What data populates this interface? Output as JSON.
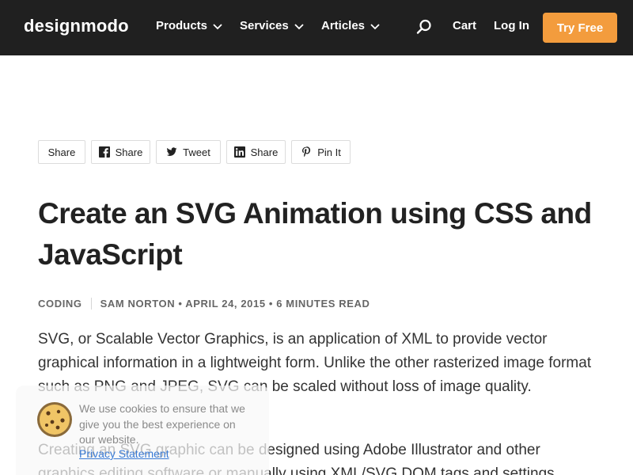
{
  "nav": {
    "logo": "designmodo",
    "items": [
      {
        "label": "Products"
      },
      {
        "label": "Services"
      },
      {
        "label": "Articles"
      }
    ],
    "cart": "Cart",
    "login": "Log In",
    "cta": "Try Free",
    "colors": {
      "bar": "#202020",
      "cta": "#f39c3d"
    }
  },
  "share": [
    {
      "label": "Share",
      "icon": ""
    },
    {
      "label": "Share",
      "icon": "facebook-icon"
    },
    {
      "label": "Tweet",
      "icon": "twitter-icon"
    },
    {
      "label": "Share",
      "icon": "linkedin-icon"
    },
    {
      "label": "Pin It",
      "icon": "pinterest-icon"
    }
  ],
  "article": {
    "title": "Create an SVG Animation using CSS and JavaScript",
    "category": "CODING",
    "byline": "SAM NORTON • APRIL 24, 2015 • 6 MINUTES READ",
    "paragraphs": [
      "SVG, or Scalable Vector Graphics, is an application of XML to provide vector graphical information in a lightweight form. Unlike the other rasterized image format such as PNG and JPEG, SVG can be scaled without loss of image quality.",
      "Creating an SVG graphic can be designed using Adobe Illustrator and other graphics editing software or manually using XML/SVG DOM tags and settings"
    ]
  },
  "cookie": {
    "text": "We use cookies to ensure that we give you the best experience on our website.",
    "link": "Privacy Statement",
    "icon": "cookie-icon"
  }
}
